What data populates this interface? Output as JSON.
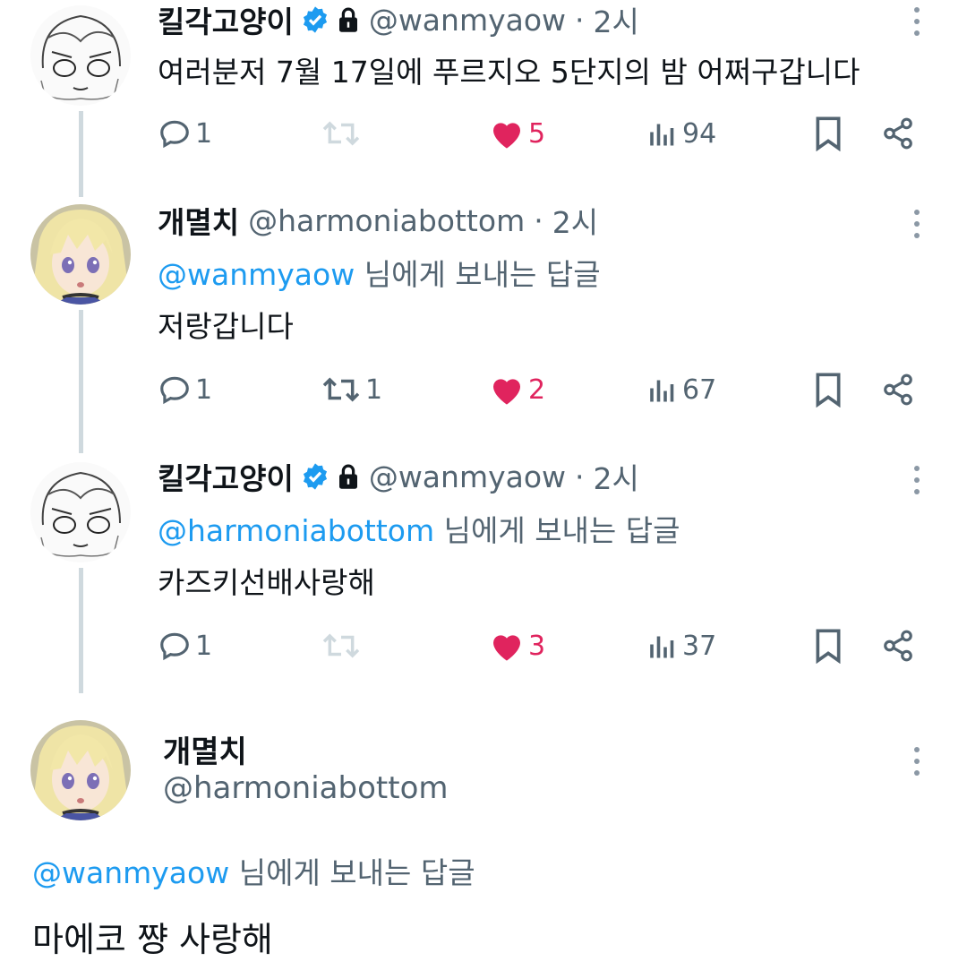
{
  "colors": {
    "link": "#1d9bf0",
    "like": "#e0245e",
    "muted": "#536471",
    "verified": "#1d9bf0"
  },
  "tweets": [
    {
      "name": "킬각고양이",
      "handle": "@wanmyaow",
      "sep": "·",
      "time": "2시",
      "verified": true,
      "locked": true,
      "lines": [
        "여러분저 7월 17일에 푸르지오 5단지의 밤 어쩌구갑니다"
      ],
      "replies": "1",
      "retweets": "",
      "likes": "5",
      "views": "94",
      "liked": true
    },
    {
      "name": "개멸치",
      "handle": "@harmoniabottom",
      "sep": "·",
      "time": "2시",
      "reply_to": "@wanmyaow",
      "reply_suffix": "님에게 보내는 답글",
      "lines": [
        "저랑갑니다"
      ],
      "replies": "1",
      "retweets": "1",
      "likes": "2",
      "views": "67",
      "liked": true
    },
    {
      "name": "킬각고양이",
      "handle": "@wanmyaow",
      "sep": "·",
      "time": "2시",
      "verified": true,
      "locked": true,
      "reply_to": "@harmoniabottom",
      "reply_suffix": "님에게 보내는 답글",
      "lines": [
        "카즈키선배사랑해"
      ],
      "replies": "1",
      "retweets": "",
      "likes": "3",
      "views": "37",
      "liked": true
    }
  ],
  "focused": {
    "name": "개멸치",
    "handle": "@harmoniabottom",
    "reply_to": "@wanmyaow",
    "reply_suffix": "님에게 보내는 답글",
    "text": "마에코 쨩 사랑해"
  },
  "icons": {
    "avatar_cat": "sketch-avatar-icon",
    "avatar_girl": "anime-avatar-icon",
    "verified": "verified-badge-icon",
    "lock": "lock-icon",
    "more": "more-dots-icon",
    "reply": "reply-icon",
    "retweet": "retweet-icon",
    "like": "heart-icon",
    "views": "views-icon",
    "bookmark": "bookmark-icon",
    "share": "share-icon"
  }
}
